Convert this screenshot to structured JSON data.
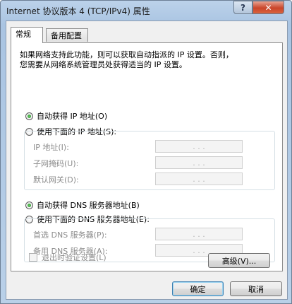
{
  "window": {
    "title": "Internet 协议版本 4 (TCP/IPv4) 属性",
    "help_label": "?",
    "close_label": "✕"
  },
  "tabs": [
    {
      "label": "常规",
      "active": true
    },
    {
      "label": "备用配置",
      "active": false
    }
  ],
  "description": {
    "line1": "如果网络支持此功能，则可以获取自动指派的 IP 设置。否则，",
    "line2": "您需要从网络系统管理员处获得适当的 IP 设置。"
  },
  "ip": {
    "auto_label": "自动获得 IP 地址(O)",
    "auto_selected": true,
    "manual_label": "使用下面的 IP 地址(S):",
    "fields": [
      {
        "label": "IP 地址(I):",
        "value": ". . ."
      },
      {
        "label": "子网掩码(U):",
        "value": ". . ."
      },
      {
        "label": "默认网关(D):",
        "value": ". . ."
      }
    ]
  },
  "dns": {
    "auto_label": "自动获得 DNS 服务器地址(B)",
    "auto_selected": true,
    "manual_label": "使用下面的 DNS 服务器地址(E):",
    "fields": [
      {
        "label": "首选 DNS 服务器(P):",
        "value": ". . ."
      },
      {
        "label": "备用 DNS 服务器(A):",
        "value": ". . ."
      }
    ]
  },
  "validate_label": "退出时验证设置(L)",
  "buttons": {
    "advanced": "高级(V)...",
    "ok": "确定",
    "cancel": "取消"
  }
}
